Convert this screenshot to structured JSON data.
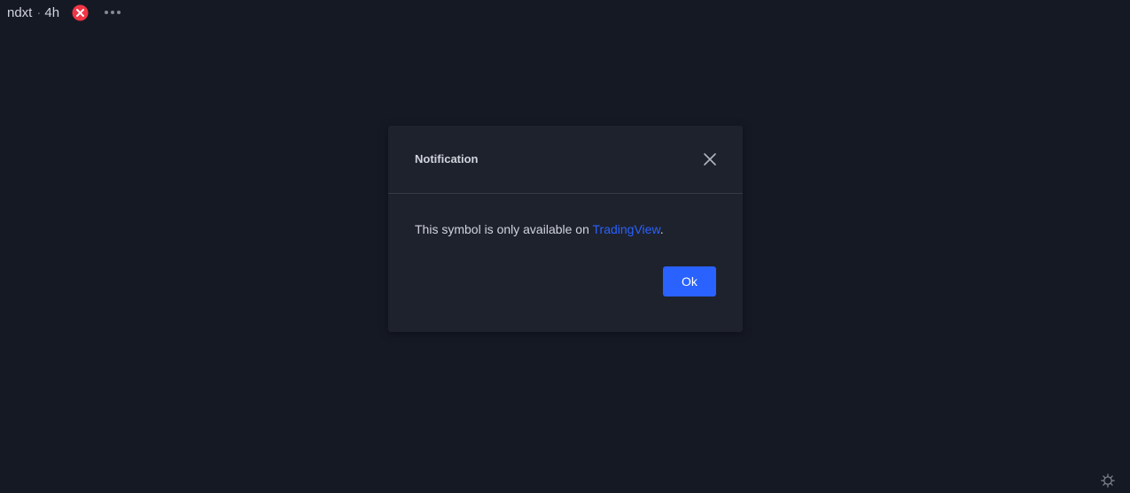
{
  "legend": {
    "symbol": "ndxt",
    "separator": "·",
    "interval": "4h",
    "error_icon": "error-circle-icon",
    "more_icon": "ellipsis-icon"
  },
  "dialog": {
    "title": "Notification",
    "close_icon": "close-icon",
    "message_prefix": "This symbol is only available on ",
    "message_link": "TradingView",
    "message_suffix": ".",
    "ok_label": "Ok"
  },
  "corner": {
    "settings_icon": "gear-icon"
  },
  "colors": {
    "background": "#151924",
    "dialog": "#1e222d",
    "accent": "#2962ff",
    "error": "#f23645",
    "text": "#d1d4dc"
  }
}
